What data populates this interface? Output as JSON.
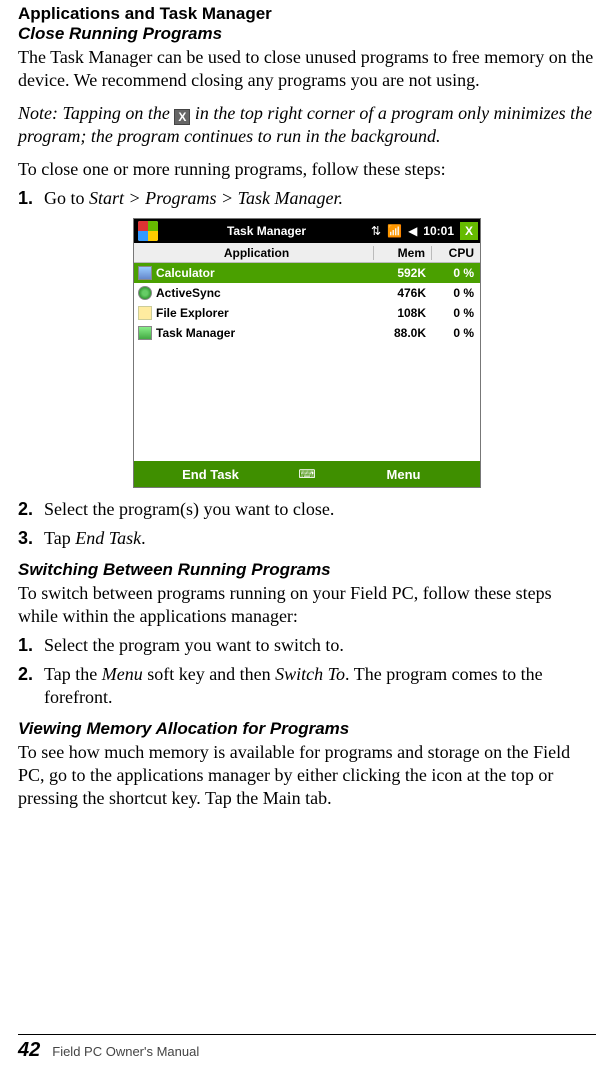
{
  "heading1": "Applications and Task Manager",
  "sub1": "Close Running Programs",
  "para1": "The Task Manager can be used to close unused programs to free memory on the device. We recommend closing any programs you are not using.",
  "note_pre": "Note: Tapping on the ",
  "note_post": " in the top right corner of a program only minimizes the program; the program continues to run in the background.",
  "para2": "To close one or more running programs, follow these steps:",
  "steps1": [
    {
      "n": "1.",
      "pre": "Go to ",
      "it": "Start > Programs > Task Manager.",
      "post": ""
    }
  ],
  "screenshot": {
    "title": "Task Manager",
    "time": "10:01",
    "close_x": "X",
    "columns": {
      "app": "Application",
      "mem": "Mem",
      "cpu": "CPU"
    },
    "rows": [
      {
        "name": "Calculator",
        "mem": "592K",
        "cpu": "0 %",
        "sel": true,
        "icon": "ic-calc"
      },
      {
        "name": "ActiveSync",
        "mem": "476K",
        "cpu": "0 %",
        "sel": false,
        "icon": "ic-sync"
      },
      {
        "name": "File Explorer",
        "mem": "108K",
        "cpu": "0 %",
        "sel": false,
        "icon": "ic-file"
      },
      {
        "name": "Task Manager",
        "mem": "88.0K",
        "cpu": "0 %",
        "sel": false,
        "icon": "ic-tm"
      }
    ],
    "soft_left": "End Task",
    "soft_mid": "⌨",
    "soft_right": "Menu"
  },
  "steps2": [
    {
      "n": "2.",
      "pre": "Select the program(s) you want to close.",
      "it": "",
      "post": ""
    },
    {
      "n": "3.",
      "pre": "Tap ",
      "it": "End Task",
      "post": "."
    }
  ],
  "sub2": "Switching Between Running Programs",
  "para3": "To switch between programs running on your Field PC, follow these steps while within the applications manager:",
  "steps3": [
    {
      "n": "1.",
      "pre": "Select the program you want to switch to.",
      "it": "",
      "post": ""
    },
    {
      "n": "2.",
      "pre": "Tap the ",
      "it": "Menu",
      "mid": " soft key and then ",
      "it2": "Switch To",
      "post": ". The program comes to the forefront."
    }
  ],
  "sub3": "Viewing Memory Allocation for Programs",
  "para4": "To see how much memory is available for programs and storage on the Field PC, go to the applications manager by either clicking the icon at the top or pressing the shortcut key. Tap the Main tab.",
  "footer": {
    "page": "42",
    "title": "Field PC Owner's Manual"
  }
}
